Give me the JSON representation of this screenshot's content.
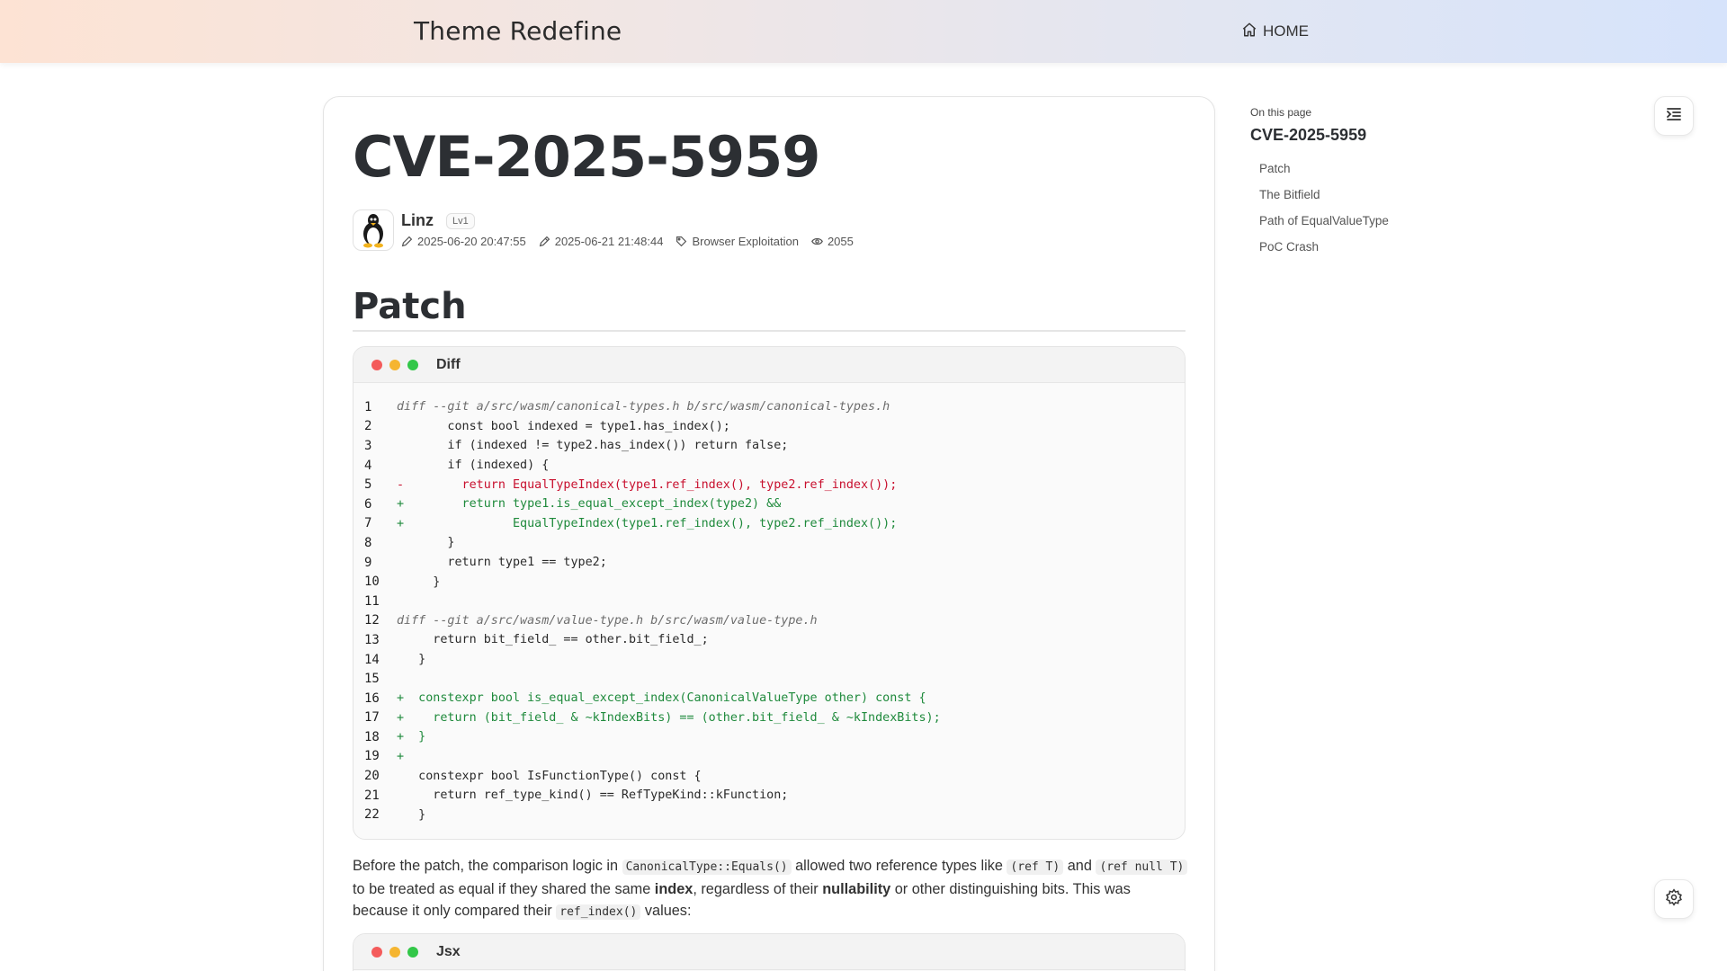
{
  "site": {
    "brand": "Theme Redefine",
    "nav_home": "HOME"
  },
  "article": {
    "title": "CVE-2025-5959",
    "author": "Linz",
    "level": "Lv1",
    "created": "2025-06-20 20:47:55",
    "updated": "2025-06-21 21:48:44",
    "category": "Browser Exploitation",
    "views": "2055",
    "section_patch": "Patch"
  },
  "code_diff": {
    "lang": "Diff",
    "lines": [
      {
        "n": "1",
        "t": "diff --git a/src/wasm/canonical-types.h b/src/wasm/canonical-types.h",
        "k": "comment"
      },
      {
        "n": "2",
        "t": "       const bool indexed = type1.has_index();",
        "k": ""
      },
      {
        "n": "3",
        "t": "       if (indexed != type2.has_index()) return false;",
        "k": ""
      },
      {
        "n": "4",
        "t": "       if (indexed) {",
        "k": ""
      },
      {
        "n": "5",
        "t": "-        return EqualTypeIndex(type1.ref_index(), type2.ref_index());",
        "k": "del"
      },
      {
        "n": "6",
        "t": "+        return type1.is_equal_except_index(type2) &&",
        "k": "add"
      },
      {
        "n": "7",
        "t": "+               EqualTypeIndex(type1.ref_index(), type2.ref_index());",
        "k": "add"
      },
      {
        "n": "8",
        "t": "       }",
        "k": ""
      },
      {
        "n": "9",
        "t": "       return type1 == type2;",
        "k": ""
      },
      {
        "n": "10",
        "t": "     }",
        "k": ""
      },
      {
        "n": "11",
        "t": "",
        "k": ""
      },
      {
        "n": "12",
        "t": "diff --git a/src/wasm/value-type.h b/src/wasm/value-type.h",
        "k": "comment"
      },
      {
        "n": "13",
        "t": "     return bit_field_ == other.bit_field_;",
        "k": ""
      },
      {
        "n": "14",
        "t": "   }",
        "k": ""
      },
      {
        "n": "15",
        "t": "",
        "k": ""
      },
      {
        "n": "16",
        "t": "+  constexpr bool is_equal_except_index(CanonicalValueType other) const {",
        "k": "add"
      },
      {
        "n": "17",
        "t": "+    return (bit_field_ & ~kIndexBits) == (other.bit_field_ & ~kIndexBits);",
        "k": "add"
      },
      {
        "n": "18",
        "t": "+  }",
        "k": "add"
      },
      {
        "n": "19",
        "t": "+",
        "k": "add"
      },
      {
        "n": "20",
        "t": "   constexpr bool IsFunctionType() const {",
        "k": ""
      },
      {
        "n": "21",
        "t": "     return ref_type_kind() == RefTypeKind::kFunction;",
        "k": ""
      },
      {
        "n": "22",
        "t": "   }",
        "k": ""
      }
    ]
  },
  "paragraph": {
    "p1": "Before the patch, the comparison logic in ",
    "c1": "CanonicalType::Equals()",
    "p2": " allowed two reference types like ",
    "c2": "(ref T)",
    "p3": " and ",
    "c3": "(ref null T)",
    "p4": " to be treated as equal if they shared the same ",
    "b1": "index",
    "p5": ", regardless of their ",
    "b2": "nullability",
    "p6": " or other distinguishing bits. This was because it only compared their ",
    "c4": "ref_index()",
    "p7": " values:"
  },
  "code_jsx": {
    "lang": "Jsx"
  },
  "toc": {
    "label": "On this page",
    "title": "CVE-2025-5959",
    "items": [
      "Patch",
      "The Bitfield",
      "Path of EqualValueType",
      "PoC Crash"
    ]
  },
  "icons": {
    "home": "home-icon",
    "toc_toggle": "indent-list-icon",
    "settings": "gear-icon"
  }
}
